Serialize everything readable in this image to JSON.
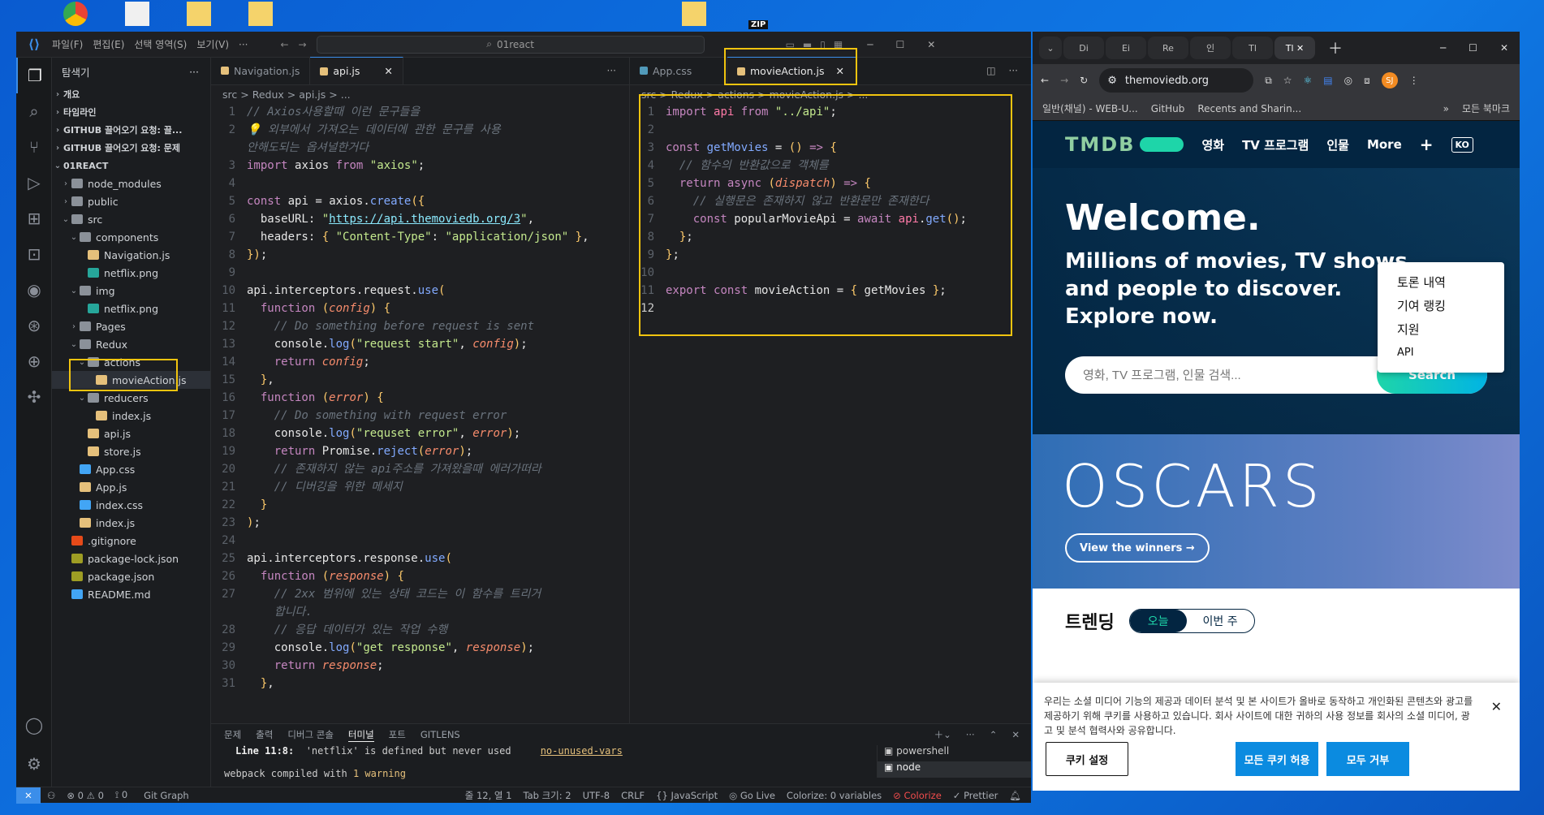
{
  "vscode": {
    "menu": [
      "파일(F)",
      "편집(E)",
      "선택 영역(S)",
      "보기(V)",
      "···"
    ],
    "search_value": "01react",
    "explorer_title": "탐색기",
    "sections": [
      "개요",
      "타임라인",
      "GITHUB 끌어오기 요청: 끌...",
      "GITHUB 끌어오기 요청: 문제",
      "01REACT"
    ],
    "tree": [
      {
        "label": "node_modules",
        "icon": "folder-icon"
      },
      {
        "label": "public",
        "icon": "folder-icon"
      },
      {
        "label": "src",
        "icon": "folder-icon"
      },
      {
        "label": "components",
        "icon": "folder-icon"
      },
      {
        "label": "Navigation.js",
        "icon": "js-file-icon"
      },
      {
        "label": "netflix.png",
        "icon": "image-file-icon"
      },
      {
        "label": "img",
        "icon": "folder-icon"
      },
      {
        "label": "netflix.png",
        "icon": "image-file-icon"
      },
      {
        "label": "Pages",
        "icon": "folder-icon"
      },
      {
        "label": "Redux",
        "icon": "folder-icon"
      },
      {
        "label": "actions",
        "icon": "folder-icon"
      },
      {
        "label": "movieAction.js",
        "icon": "js-file-icon"
      },
      {
        "label": "reducers",
        "icon": "folder-icon"
      },
      {
        "label": "index.js",
        "icon": "js-file-icon"
      },
      {
        "label": "api.js",
        "icon": "js-file-icon"
      },
      {
        "label": "store.js",
        "icon": "js-file-icon"
      },
      {
        "label": "App.css",
        "icon": "css-file-icon"
      },
      {
        "label": "App.js",
        "icon": "js-file-icon"
      },
      {
        "label": "index.css",
        "icon": "css-file-icon"
      },
      {
        "label": "index.js",
        "icon": "js-file-icon"
      },
      {
        "label": ".gitignore",
        "icon": "git-file-icon"
      },
      {
        "label": "package-lock.json",
        "icon": "json-file-icon"
      },
      {
        "label": "package.json",
        "icon": "json-file-icon"
      },
      {
        "label": "README.md",
        "icon": "info-file-icon"
      }
    ],
    "left_tabs": [
      "Navigation.js",
      "api.js"
    ],
    "left_crumb": [
      "src",
      ">",
      "Redux",
      ">",
      "api.js",
      ">",
      "..."
    ],
    "right_tabs": [
      "App.css",
      "movieAction.js"
    ],
    "right_crumb": "src > Redux > actions > movieAction.js > ...",
    "panel_tabs": [
      "문제",
      "출력",
      "디버그 콘솔",
      "터미널",
      "포트",
      "GITLENS"
    ],
    "terminal_line1_prefix": "Line 11:8:",
    "terminal_line1_msg": "'netflix' is defined but never used",
    "terminal_line1_rule": "no-unused-vars",
    "terminal_line2": "webpack compiled with",
    "terminal_warn": "1 warning",
    "terminals": [
      "powershell",
      "node"
    ],
    "status": {
      "errors": "0",
      "warnings": "0",
      "ports": "0",
      "gitgraph": "Git Graph",
      "position": "줄 12, 열 1",
      "tabsize": "Tab 크기: 2",
      "encoding": "UTF-8",
      "eol": "CRLF",
      "lang": "JavaScript",
      "golive": "Go Live",
      "colorize": "Colorize: 0 variables",
      "colorize2": "Colorize",
      "prettier": "Prettier"
    }
  },
  "chrome": {
    "tabs": [
      "Di",
      "Ei",
      "Re",
      "인",
      "Tl",
      "Tl"
    ],
    "url": "themoviedb.org",
    "bookmarks": [
      "일반(채널) - WEB-U...",
      "GitHub",
      "Recents and Sharin...",
      "»",
      "모든 북마크"
    ],
    "profile": "SJ"
  },
  "tmdb": {
    "logo": "TMDB",
    "nav": [
      "영화",
      "TV 프로그램",
      "인물",
      "More",
      "+",
      "KO"
    ],
    "dropdown": [
      "토론 내역",
      "기여 랭킹",
      "지원",
      "API"
    ],
    "welcome": "Welcome.",
    "subtitle": "Millions of movies, TV shows and people to discover. Explore now.",
    "search_placeholder": "영화, TV 프로그램, 인물 검색...",
    "search_button": "Search",
    "oscars": "OSCARS",
    "winners": "View the winners →",
    "trending": "트렌딩",
    "trend_tabs": [
      "오늘",
      "이번 주"
    ],
    "cookie_text": "우리는 소셜 미디어 기능의 제공과 데이터 분석 및 본 사이트가 올바로 동작하고 개인화된 콘텐츠와 광고를 제공하기 위해 쿠키를 사용하고 있습니다. 회사 사이트에 대한 귀하의 사용 정보를 회사의 소셜 미디어, 광고 및 분석 협력사와 공유합니다.",
    "cookie_settings": "쿠키 설정",
    "cookie_accept": "모든 쿠키 허용",
    "cookie_reject": "모두 거부"
  },
  "desktop": {
    "zip_label": "ZIP"
  }
}
